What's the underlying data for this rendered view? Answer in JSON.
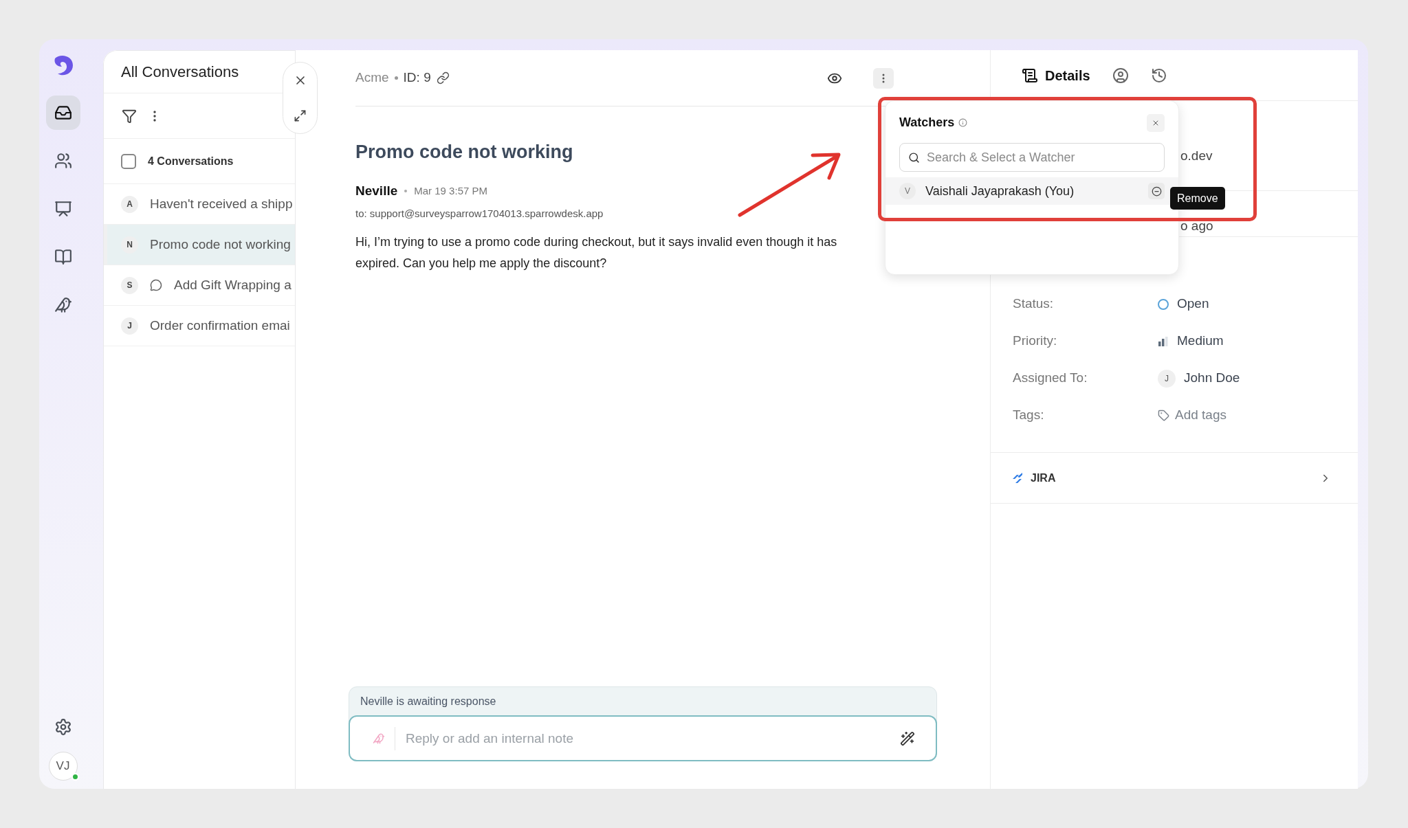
{
  "nav": {
    "items": [
      {
        "kind": "inbox",
        "selected": true
      },
      {
        "kind": "contacts",
        "selected": false
      },
      {
        "kind": "reports",
        "selected": false
      },
      {
        "kind": "knowledge",
        "selected": false
      },
      {
        "kind": "bot",
        "selected": false
      }
    ],
    "avatar": "VJ",
    "online": true
  },
  "conversations": {
    "title": "All Conversations",
    "count_label": "4 Conversations",
    "select_all_checked": false,
    "items": [
      {
        "initial": "A",
        "subject": "Haven't received a shipp",
        "selected": false,
        "chat_icon": false
      },
      {
        "initial": "N",
        "subject": "Promo code not working",
        "selected": true,
        "chat_icon": false
      },
      {
        "initial": "S",
        "subject": "Add Gift Wrapping a",
        "selected": false,
        "chat_icon": true
      },
      {
        "initial": "J",
        "subject": "Order confirmation emai",
        "selected": false,
        "chat_icon": false
      }
    ]
  },
  "conversation": {
    "account": "Acme",
    "id_label": "ID: 9",
    "title": "Promo code not working",
    "message": {
      "author": "Neville",
      "time": "Mar 19 3:57 PM",
      "to": "to: support@surveysparrow1704013.sparrowdesk.app",
      "body_lines": [
        "Hi, I’m trying to use a promo code during checkout, but it says invalid even though it has",
        "expired. Can you help me apply the discount?"
      ]
    },
    "awaiting": "Neville is awaiting response",
    "reply_placeholder": "Reply or add an internal note"
  },
  "details": {
    "tabs": [
      {
        "kind": "details",
        "label": "Details",
        "selected": true
      },
      {
        "kind": "contact",
        "selected": false
      },
      {
        "kind": "history",
        "selected": false
      }
    ],
    "partial_rows": [
      "o.dev",
      "o ago"
    ],
    "fields": [
      {
        "kind": "status",
        "label": "Status:",
        "value": "Open"
      },
      {
        "kind": "priority",
        "label": "Priority:",
        "value": "Medium"
      },
      {
        "kind": "assignee",
        "label": "Assigned To:",
        "value": "John Doe",
        "initial": "J"
      },
      {
        "kind": "tags",
        "label": "Tags:",
        "value": "Add tags"
      }
    ],
    "integration": "JIRA"
  },
  "watchers": {
    "title": "Watchers",
    "search_placeholder": "Search & Select a Watcher",
    "items": [
      {
        "initial": "V",
        "name": "Vaishali Jayaprakash (You)"
      }
    ],
    "tooltip": "Remove"
  }
}
